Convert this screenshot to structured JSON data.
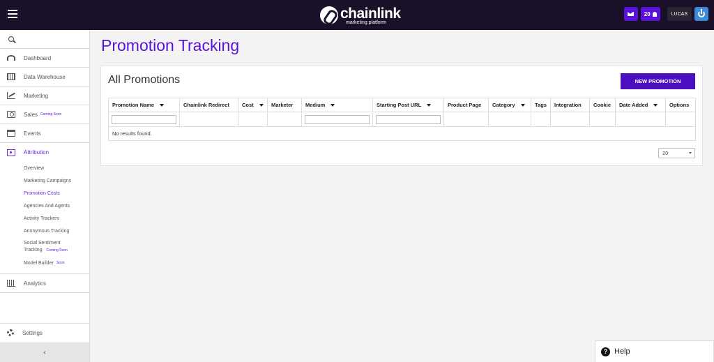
{
  "header": {
    "logo_name": "chainlink",
    "logo_tagline": "marketing platform",
    "notifications_count": "20",
    "user_name": "LUCAS"
  },
  "sidebar": {
    "items": [
      {
        "label": "Dashboard",
        "icon": "dashboard-icon"
      },
      {
        "label": "Data Warehouse",
        "icon": "warehouse-icon"
      },
      {
        "label": "Marketing",
        "icon": "chart-icon"
      },
      {
        "label": "Sales",
        "icon": "money-icon",
        "badge": "Coming Soon"
      },
      {
        "label": "Events",
        "icon": "calendar-icon"
      },
      {
        "label": "Attribution",
        "icon": "attribution-icon"
      }
    ],
    "sub_items": [
      {
        "label": "Overview"
      },
      {
        "label": "Marketing Campaigns"
      },
      {
        "label": "Promotion Costs"
      },
      {
        "label": "Agencies And Agents"
      },
      {
        "label": "Activity Trackers"
      },
      {
        "label": "Anonymous Tracking"
      },
      {
        "label": "Social Sentiment",
        "label2": "Tracking",
        "badge": "Coming Soon"
      },
      {
        "label": "Model Builder",
        "badge": "Soon"
      }
    ],
    "analytics_label": "Analytics",
    "settings_label": "Settings",
    "collapse_glyph": "‹"
  },
  "page": {
    "title": "Promotion Tracking"
  },
  "card": {
    "title": "All Promotions",
    "new_button": "NEW PROMOTION",
    "columns": [
      {
        "label": "Promotion Name",
        "sortable": true
      },
      {
        "label": "Chainlink Redirect",
        "sortable": false
      },
      {
        "label": "Cost",
        "sortable": true
      },
      {
        "label": "Marketer",
        "sortable": false
      },
      {
        "label": "Medium",
        "sortable": true
      },
      {
        "label": "Starting Post URL",
        "sortable": true
      },
      {
        "label": "Product Page",
        "sortable": false
      },
      {
        "label": "Category",
        "sortable": true
      },
      {
        "label": "Tags",
        "sortable": false
      },
      {
        "label": "Integration",
        "sortable": false
      },
      {
        "label": "Cookie",
        "sortable": false
      },
      {
        "label": "Date Added",
        "sortable": true
      },
      {
        "label": "Options",
        "sortable": false
      }
    ],
    "empty_text": "No results found.",
    "page_size": "20"
  },
  "help": {
    "label": "Help",
    "icon_glyph": "?"
  },
  "colors": {
    "topbar": "#1a1029",
    "accent": "#5b12d8",
    "button": "#4a0fbf"
  }
}
